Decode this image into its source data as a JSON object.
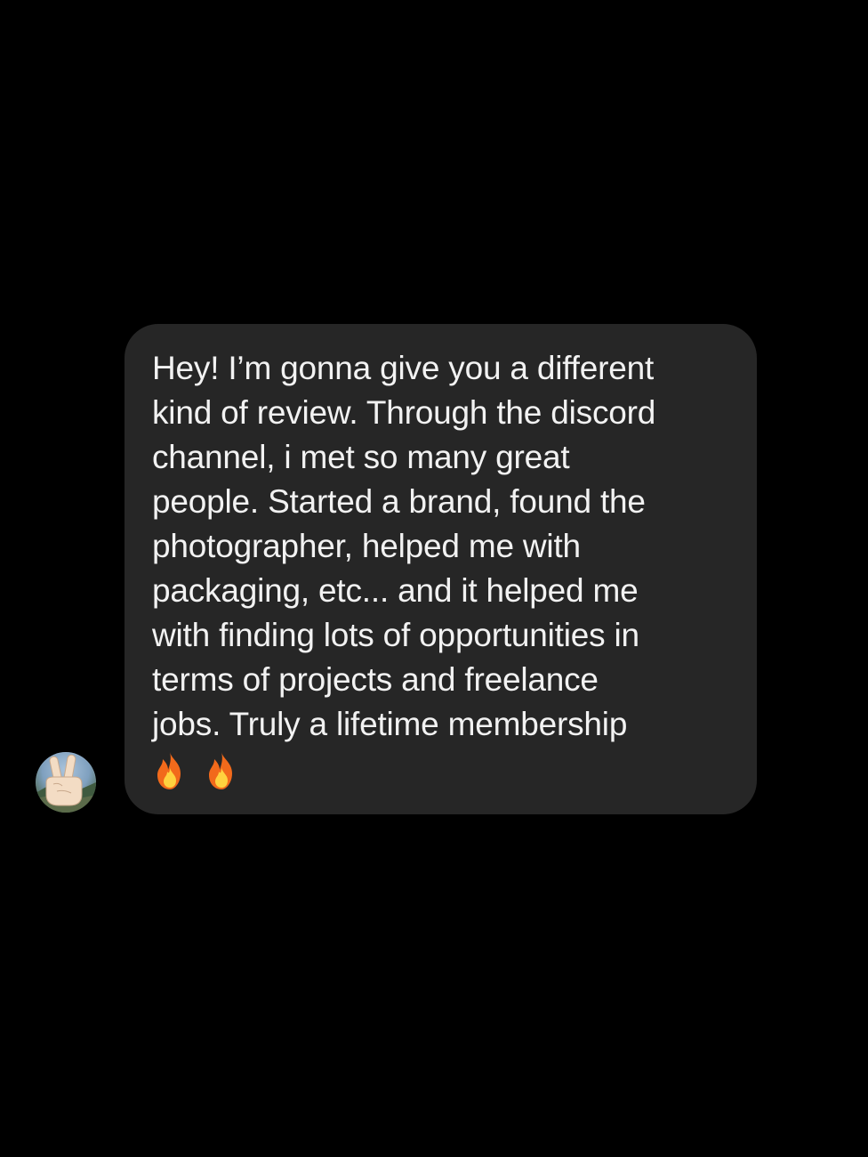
{
  "conversation": {
    "incoming_message": {
      "text": "Hey! I’m gonna give you a different\nkind of review. Through the discord\nchannel, i met so many great\npeople. Started a brand, found the\nphotographer, helped me with\npackaging, etc... and it helped me\nwith finding lots of opportunities in\nterms of projects and freelance\njobs. Truly a lifetime membership",
      "emoji": [
        "fire-icon",
        "fire-icon"
      ]
    },
    "sender_avatar": {
      "icon": "victory-hand-icon"
    }
  },
  "colors": {
    "background": "#000000",
    "bubble": "#262626",
    "text": "#f2f2f2",
    "fire_outer": "#f26a1b",
    "fire_inner": "#ffd23f"
  }
}
